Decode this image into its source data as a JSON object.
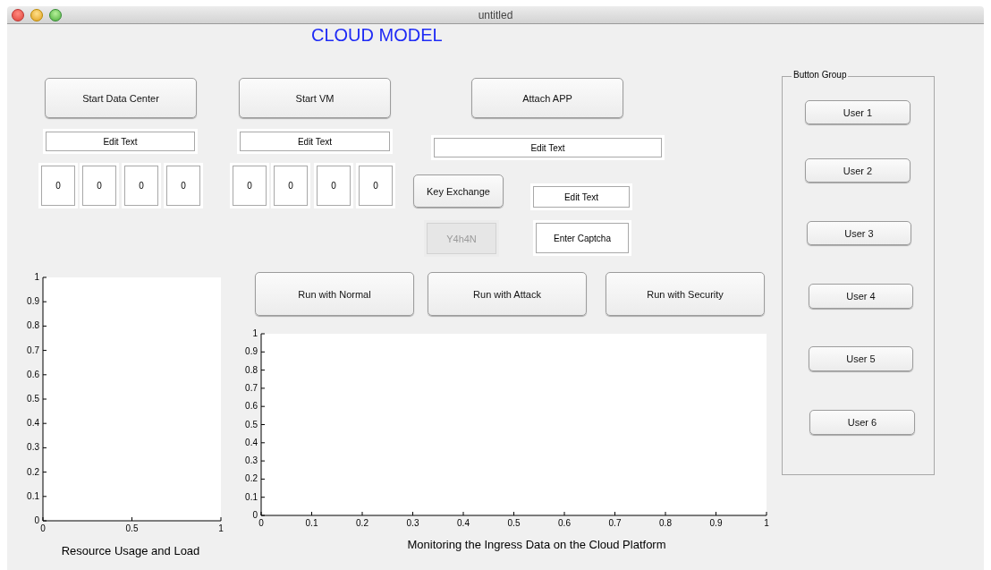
{
  "window": {
    "title": "untitled"
  },
  "heading": "CLOUD MODEL",
  "controls": [
    {
      "kind": "button",
      "label": "Start Data Center",
      "disabled": false
    },
    {
      "kind": "button",
      "label": "Start VM",
      "disabled": false
    },
    {
      "kind": "button",
      "label": "Attach APP",
      "disabled": false
    },
    {
      "kind": "field",
      "value": "Edit Text"
    },
    {
      "kind": "field",
      "value": "Edit Text"
    },
    {
      "kind": "field",
      "value": "Edit Text"
    },
    {
      "kind": "field",
      "value": "0"
    },
    {
      "kind": "field",
      "value": "0"
    },
    {
      "kind": "field",
      "value": "0"
    },
    {
      "kind": "field",
      "value": "0"
    },
    {
      "kind": "field",
      "value": "0"
    },
    {
      "kind": "field",
      "value": "0"
    },
    {
      "kind": "field",
      "value": "0"
    },
    {
      "kind": "field",
      "value": "0"
    },
    {
      "kind": "button",
      "label": "Key Exchange",
      "disabled": false
    },
    {
      "kind": "field",
      "value": "Edit Text"
    },
    {
      "kind": "button",
      "label": "Y4h4N",
      "disabled": true
    },
    {
      "kind": "field",
      "value": "Enter Captcha"
    },
    {
      "kind": "button",
      "label": "Run with Normal",
      "disabled": false
    },
    {
      "kind": "button",
      "label": "Run with Attack",
      "disabled": false
    },
    {
      "kind": "button",
      "label": "Run with Security",
      "disabled": false
    }
  ],
  "charts": [
    {
      "chart_data": {
        "type": "line",
        "xlabel": "Resource Usage and Load",
        "xlim": [
          0,
          1
        ],
        "ylim": [
          0,
          1
        ],
        "xticks": [
          0,
          0.5,
          1
        ],
        "yticks": [
          0,
          0.1,
          0.2,
          0.3,
          0.4,
          0.5,
          0.6,
          0.7,
          0.8,
          0.9,
          1
        ]
      }
    },
    {
      "chart_data": {
        "type": "line",
        "xlabel": "Monitoring the Ingress Data on the Cloud Platform",
        "xlim": [
          0,
          1
        ],
        "ylim": [
          0,
          1
        ],
        "xticks": [
          0,
          0.1,
          0.2,
          0.3,
          0.4,
          0.5,
          0.6,
          0.7,
          0.8,
          0.9,
          1
        ],
        "yticks": [
          0,
          0.1,
          0.2,
          0.3,
          0.4,
          0.5,
          0.6,
          0.7,
          0.8,
          0.9,
          1
        ]
      }
    }
  ],
  "button_group": {
    "title": "Button Group",
    "buttons": [
      "User 1",
      "User 2",
      "User 3",
      "User 4",
      "User 5",
      "User 6"
    ]
  }
}
